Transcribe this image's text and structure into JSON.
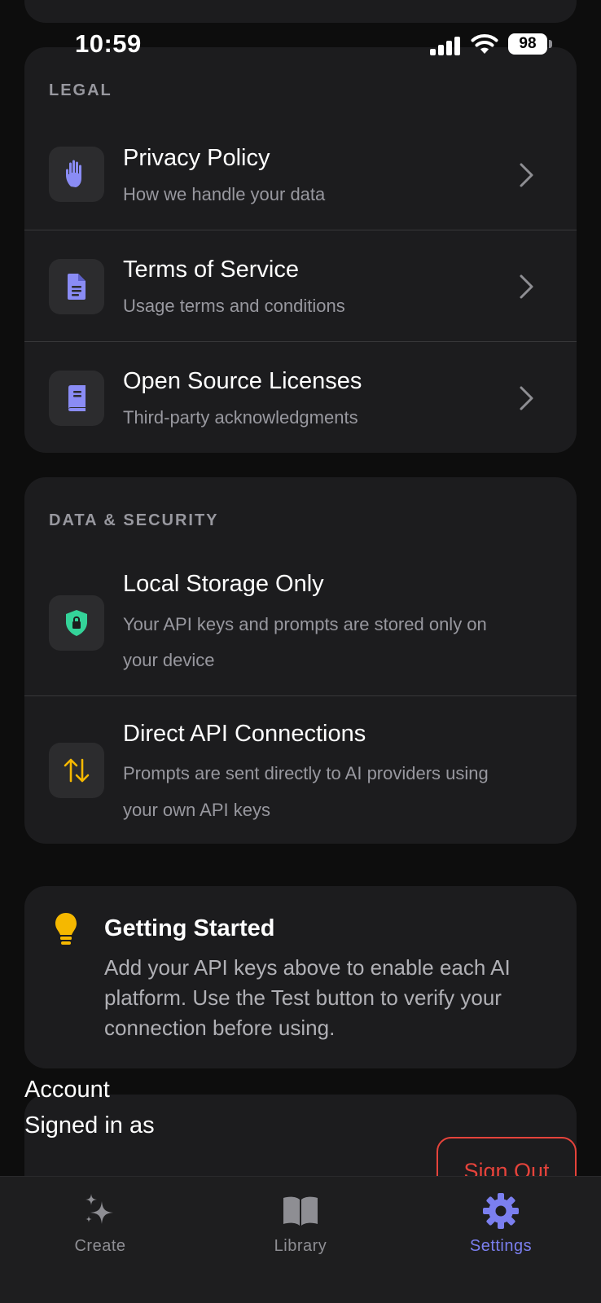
{
  "status_bar": {
    "time": "10:59",
    "battery": "98"
  },
  "legal": {
    "header": "LEGAL",
    "items": [
      {
        "title": "Privacy Policy",
        "subtitle": "How we handle your data",
        "icon": "hand-icon"
      },
      {
        "title": "Terms of Service",
        "subtitle": "Usage terms and conditions",
        "icon": "document-icon"
      },
      {
        "title": "Open Source Licenses",
        "subtitle": "Third-party acknowledgments",
        "icon": "book-icon"
      }
    ]
  },
  "data_security": {
    "header": "DATA & SECURITY",
    "items": [
      {
        "title": "Local Storage Only",
        "subtitle_line1": "Your API keys and prompts are stored only on",
        "subtitle_line2": "your device",
        "icon": "shield-lock-icon"
      },
      {
        "title": "Direct API Connections",
        "subtitle_line1": "Prompts are sent directly to AI providers using",
        "subtitle_line2": "your own API keys",
        "icon": "arrows-up-down-icon"
      }
    ]
  },
  "getting_started": {
    "title": "Getting Started",
    "line1": "Add your API keys above to enable each AI",
    "line2": "platform. Use the Test button to verify your",
    "line3": "connection before using."
  },
  "account": {
    "title": "Account",
    "signed_in_as": "Signed in as",
    "sign_out": "Sign Out"
  },
  "tabs": [
    {
      "label": "Create",
      "active": false
    },
    {
      "label": "Library",
      "active": false
    },
    {
      "label": "Settings",
      "active": true
    }
  ],
  "colors": {
    "accent": "#7b7fef",
    "danger": "#e5433b",
    "shield": "#34d399",
    "arrows": "#f5b800",
    "bulb": "#f5b800",
    "card": "#1c1c1e"
  }
}
